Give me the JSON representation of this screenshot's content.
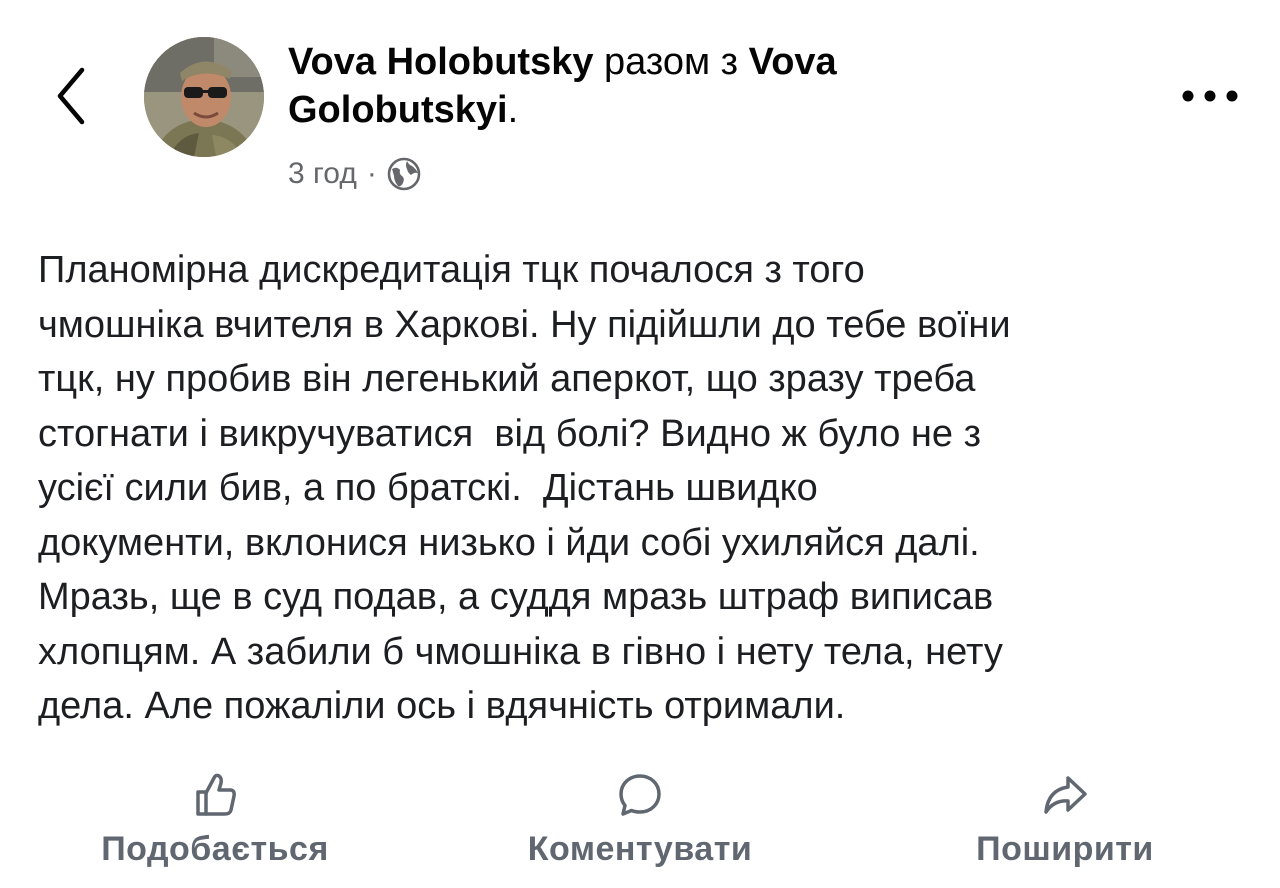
{
  "header": {
    "back_icon": "chevron-left-icon",
    "author_name": "Vova  Holobutsky",
    "with_text": "разом з",
    "coauthor_name": "Vova Golobutskyi",
    "coauthor_suffix": ".",
    "time": "3 год",
    "separator": "·",
    "audience_icon": "globe-icon",
    "more_icon": "more-horizontal-icon"
  },
  "post": {
    "text_lines": [
      "Планомірна дискредитація тцк почалося з того",
      "чмошніка вчителя в Харкові. Ну підійшли до тебе воїни",
      "тцк, ну пробив він легенький аперкот, що зразу треба",
      "стогнати і викручуватися  від болі? Видно ж було не з",
      "усієї сили бив, а по братскі.  Дістань швидко",
      "документи, вклонися низько і йди собі ухиляйся далі.",
      "Мразь, ще в суд подав, а суддя мразь штраф виписав",
      "хлопцям. А забили б чмошніка в гівно і нету тела, нету",
      "дела. Але пожаліли ось і вдячність отримали."
    ]
  },
  "actions": {
    "like_label": "Подобається",
    "like_icon": "thumbs-up-icon",
    "comment_label": "Коментувати",
    "comment_icon": "comment-bubble-icon",
    "share_label": "Поширити",
    "share_icon": "share-arrow-icon"
  },
  "colors": {
    "text_primary": "#050505",
    "text_secondary": "#65676b",
    "action_text": "#606770"
  }
}
